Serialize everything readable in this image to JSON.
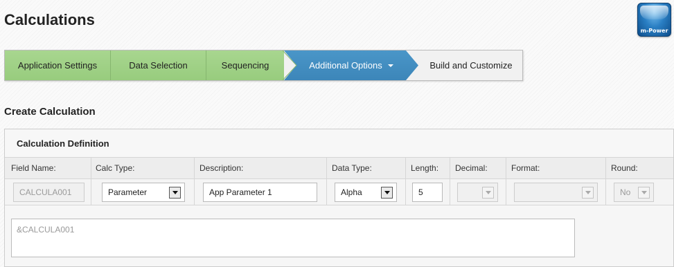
{
  "page": {
    "title": "Calculations"
  },
  "logo": {
    "label": "m-Power"
  },
  "wizard": {
    "steps": [
      {
        "label": "Application Settings",
        "state": "completed"
      },
      {
        "label": "Data Selection",
        "state": "completed"
      },
      {
        "label": "Sequencing",
        "state": "completed"
      },
      {
        "label": "Additional Options",
        "state": "active"
      },
      {
        "label": "Build and Customize",
        "state": "pending"
      }
    ]
  },
  "section": {
    "title": "Create Calculation"
  },
  "panel": {
    "title": "Calculation Definition",
    "columns": {
      "field_name": "Field Name:",
      "calc_type": "Calc Type:",
      "description": "Description:",
      "data_type": "Data Type:",
      "length": "Length:",
      "decimal": "Decimal:",
      "format": "Format:",
      "round": "Round:"
    },
    "values": {
      "field_name": "CALCULA001",
      "calc_type": "Parameter",
      "description": "App Parameter 1",
      "data_type": "Alpha",
      "length": "5",
      "decimal": "",
      "format": "",
      "round": "No"
    },
    "expression": "&CALCULA001"
  },
  "colors": {
    "completed_step": "#9fd187",
    "active_step": "#4290c2",
    "pending_step": "#f1f1f1"
  }
}
